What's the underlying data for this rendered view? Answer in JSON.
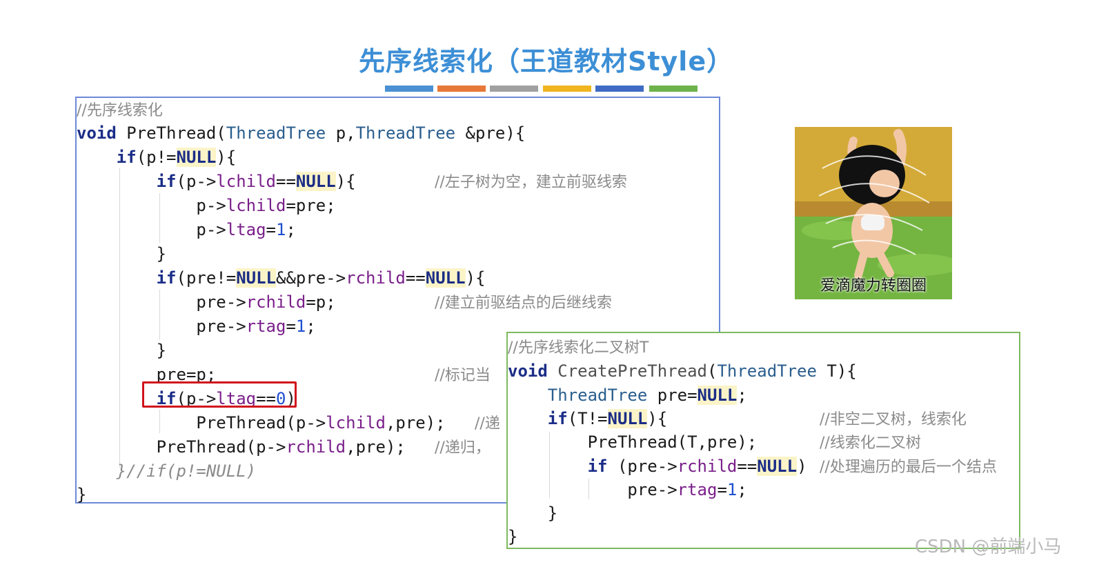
{
  "title": "先序线索化（王道教材Style）",
  "color_bar": [
    "#4a90d2",
    "#e87838",
    "#a0a0a0",
    "#f0b51f",
    "#3f6bc4",
    "#6db24a"
  ],
  "box1": {
    "c1": "//先序线索化",
    "c2": "//左子树为空，建立前驱线索",
    "c3": "//建立前驱结点的后继线索",
    "c4": "//标记当",
    "c5": "//递",
    "c6": "//递归，",
    "c7": "}//if(p!=NULL)"
  },
  "box2": {
    "c1": "//先序线索化二叉树T",
    "c2": "//非空二叉树，线索化",
    "c3": "//线索化二叉树",
    "c4": "//处理遍历的最后一个结点"
  },
  "meme": {
    "caption": "爱滴魔力转圈圈",
    "icon": "spinning-cartoon-boy-image"
  },
  "watermark": "CSDN @前端小马"
}
